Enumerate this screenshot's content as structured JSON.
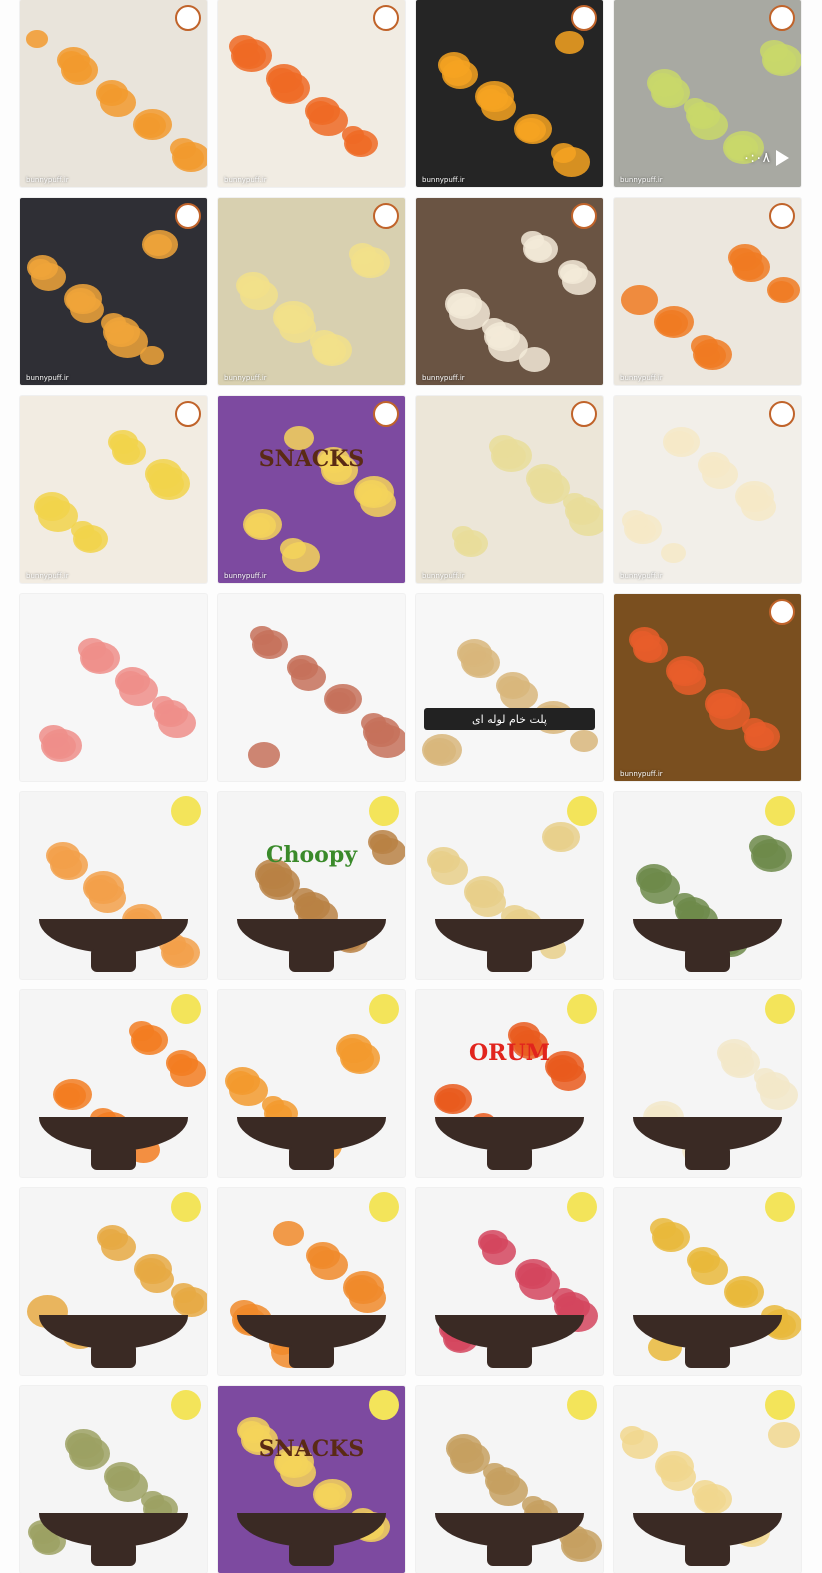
{
  "video_overlay": {
    "duration": "۰:۰۸",
    "icon": "play-icon"
  },
  "watermark": "bunnypuff.ir",
  "tiles": [
    {
      "bg": "#e9e4db",
      "accent": "#f29a2e"
    },
    {
      "bg": "#f1ece3",
      "accent": "#ee6a25"
    },
    {
      "bg": "#252525",
      "accent": "#f6a321"
    },
    {
      "bg": "#a8a9a2",
      "accent": "#c9d86a"
    },
    {
      "bg": "#2f2f35",
      "accent": "#f0a43a"
    },
    {
      "bg": "#d8d0b0",
      "accent": "#f2e08a"
    },
    {
      "bg": "#6a5443",
      "accent": "#f3ead8"
    },
    {
      "bg": "#ece7de",
      "accent": "#f07a22"
    },
    {
      "bg": "#f2ece2",
      "accent": "#f2d34b"
    },
    {
      "bg": "#7d4aa0",
      "accent": "#f4d45b",
      "title": "SNACKS"
    },
    {
      "bg": "#ece6d8",
      "accent": "#e9dd9a"
    },
    {
      "bg": "#f2efe9",
      "accent": "#f6e9c7"
    },
    {
      "bg": "#f7f7f7",
      "accent": "#ee8e8a"
    },
    {
      "bg": "#f7f7f7",
      "accent": "#c6715a"
    },
    {
      "bg": "#f7f7f7",
      "accent": "#d8b67b",
      "banner": "پلت خام لوله ای"
    },
    {
      "bg": "#7a4f1f",
      "accent": "#e85d2a"
    },
    {
      "bg": "#f5f5f5",
      "accent": "#f2a04a"
    },
    {
      "bg": "#f5f5f5",
      "accent": "#b88144",
      "title": "Choopy"
    },
    {
      "bg": "#f5f5f5",
      "accent": "#e8cf8a"
    },
    {
      "bg": "#f5f5f5",
      "accent": "#6d8a4a"
    },
    {
      "bg": "#f5f5f5",
      "accent": "#f27d21"
    },
    {
      "bg": "#f5f5f5",
      "accent": "#f29a2e"
    },
    {
      "bg": "#f5f5f5",
      "accent": "#e95b1d",
      "title": "ORUM"
    },
    {
      "bg": "#f5f5f5",
      "accent": "#f2e8c9"
    },
    {
      "bg": "#f5f5f5",
      "accent": "#e6a943"
    },
    {
      "bg": "#f5f5f5",
      "accent": "#f08a2a"
    },
    {
      "bg": "#f5f5f5",
      "accent": "#d3455e"
    },
    {
      "bg": "#f5f5f5",
      "accent": "#e9b93b"
    },
    {
      "bg": "#f5f5f5",
      "accent": "#9ca163"
    },
    {
      "bg": "#7d4aa0",
      "accent": "#f4d45b",
      "title": "SNACKS"
    },
    {
      "bg": "#f5f5f5",
      "accent": "#c6a060"
    },
    {
      "bg": "#f5f5f5",
      "accent": "#f1d78e"
    }
  ]
}
